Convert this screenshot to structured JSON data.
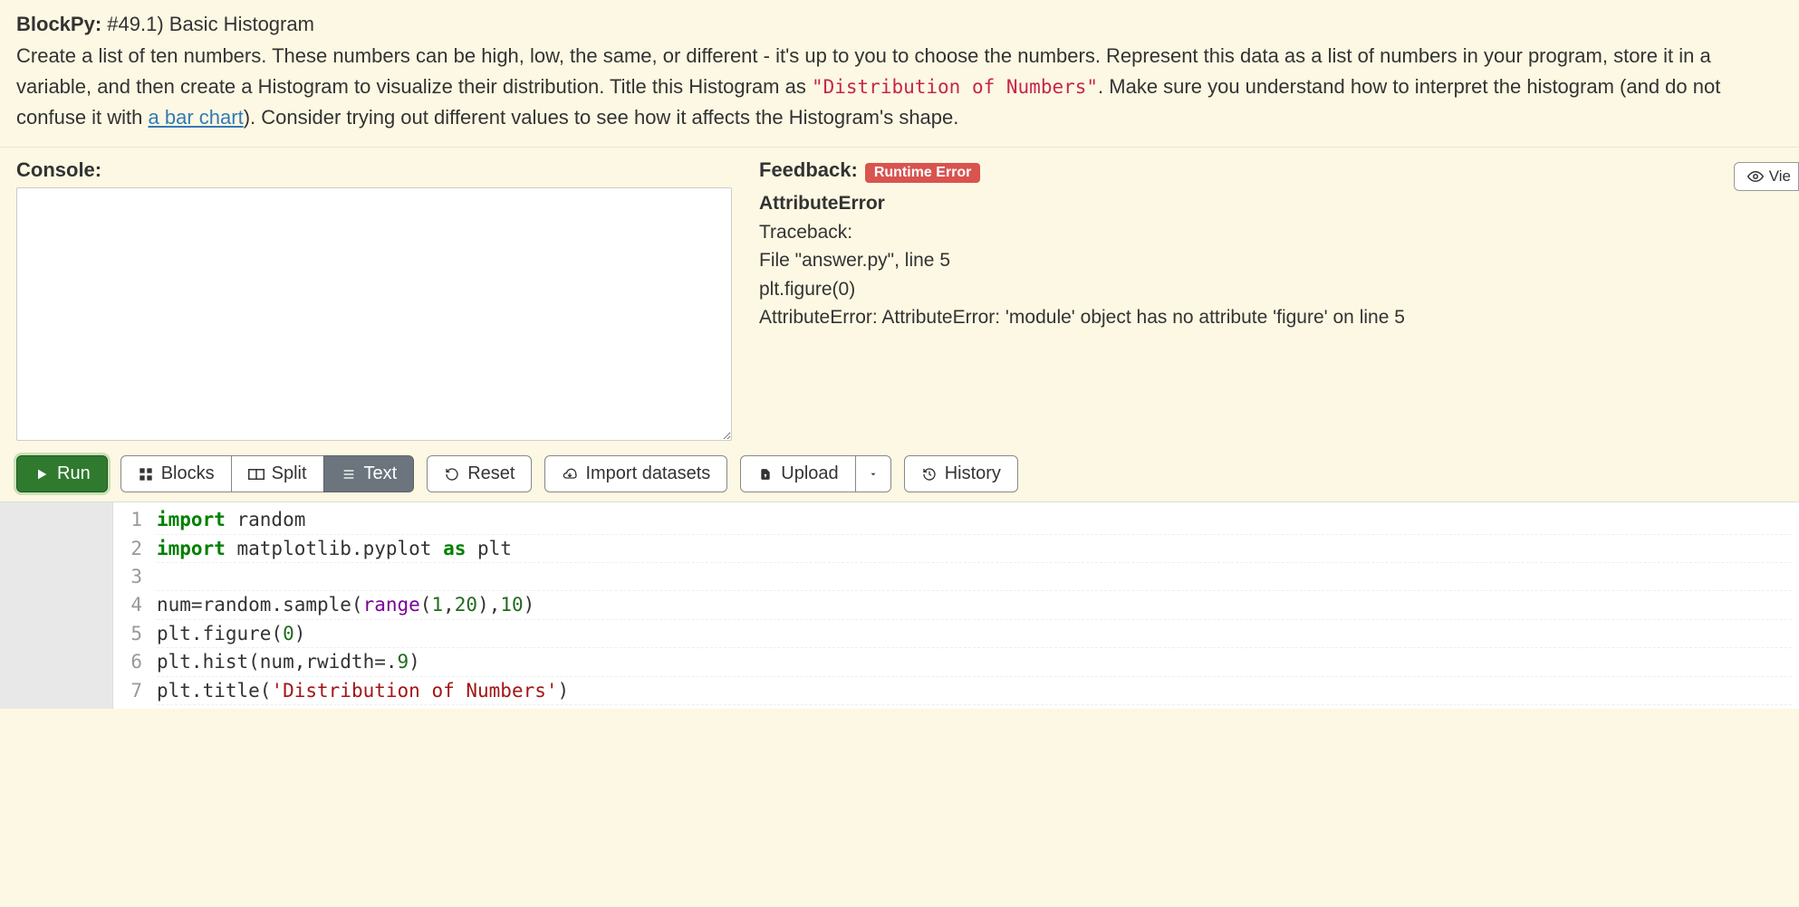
{
  "header": {
    "prefix": "BlockPy:",
    "title": "#49.1) Basic Histogram",
    "desc_1": "Create a list of ten numbers. These numbers can be high, low, the same, or different - it's up to you to choose the numbers. Represent this data as a list of numbers in your program, store it in a variable, and then create a Histogram to visualize their distribution. Title this Histogram as ",
    "desc_code": "\"Distribution of Numbers\"",
    "desc_2": ". Make sure you understand how to interpret the histogram (and do not confuse it with ",
    "link_text": "a bar chart",
    "desc_3": "). Consider trying out different values to see how it affects the Histogram's shape."
  },
  "console": {
    "label": "Console:"
  },
  "feedback": {
    "label": "Feedback:",
    "badge": "Runtime Error",
    "error_title": "AttributeError",
    "traceback_label": "Traceback:",
    "trace_file": "File \"answer.py\", line 5",
    "trace_line": "plt.figure(0)",
    "error_msg": "AttributeError: AttributeError: 'module' object has no attribute 'figure' on line 5",
    "view_btn": "Vie"
  },
  "toolbar": {
    "run": "Run",
    "blocks": "Blocks",
    "split": "Split",
    "text": "Text",
    "reset": "Reset",
    "import": "Import datasets",
    "upload": "Upload",
    "history": "History"
  },
  "code": {
    "lines": [
      "1",
      "2",
      "3",
      "4",
      "5",
      "6",
      "7"
    ],
    "l1_kw1": "import",
    "l1_mod": " random",
    "l2_kw1": "import",
    "l2_mod": " matplotlib.pyplot ",
    "l2_kw2": "as",
    "l2_al": " plt",
    "l4_a": "num=random.sample(",
    "l4_b": "range",
    "l4_c": "(",
    "l4_n1": "1",
    "l4_d": ",",
    "l4_n2": "20",
    "l4_e": "),",
    "l4_n3": "10",
    "l4_f": ")",
    "l5_a": "plt.figure(",
    "l5_n": "0",
    "l5_b": ")",
    "l6_a": "plt.hist(num,rwidth=.",
    "l6_n": "9",
    "l6_b": ")",
    "l7_a": "plt.title(",
    "l7_s": "'Distribution of Numbers'",
    "l7_b": ")"
  }
}
